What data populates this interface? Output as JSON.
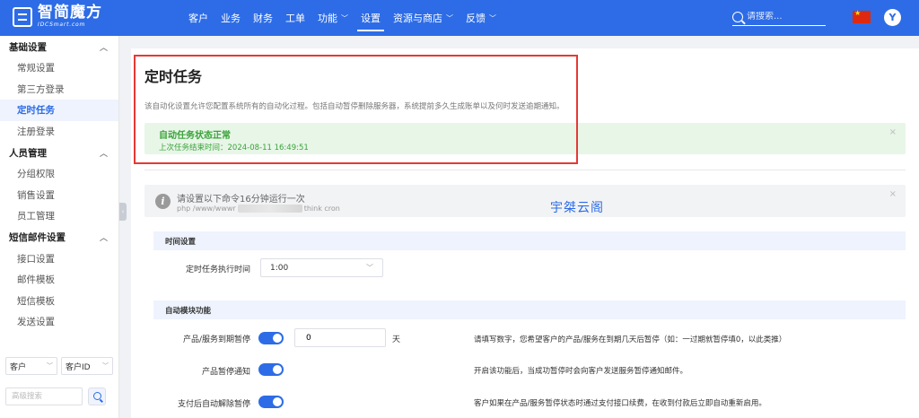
{
  "brand": {
    "name": "智简魔方",
    "sub": "IDCSmart.com"
  },
  "nav": [
    {
      "label": "客户",
      "chevron": false,
      "active": false
    },
    {
      "label": "业务",
      "chevron": false,
      "active": false
    },
    {
      "label": "财务",
      "chevron": false,
      "active": false
    },
    {
      "label": "工单",
      "chevron": false,
      "active": false
    },
    {
      "label": "功能",
      "chevron": true,
      "active": false
    },
    {
      "label": "设置",
      "chevron": false,
      "active": true
    },
    {
      "label": "资源与商店",
      "chevron": true,
      "active": false
    },
    {
      "label": "反馈",
      "chevron": true,
      "active": false
    }
  ],
  "search": {
    "placeholder": "请搜索..."
  },
  "user": {
    "avatar_letter": "Y"
  },
  "sidebar": {
    "groups": [
      {
        "title": "基础设置",
        "items": [
          {
            "label": "常规设置",
            "active": false
          },
          {
            "label": "第三方登录",
            "active": false
          },
          {
            "label": "定时任务",
            "active": true
          },
          {
            "label": "注册登录",
            "active": false
          }
        ]
      },
      {
        "title": "人员管理",
        "items": [
          {
            "label": "分组权限",
            "active": false
          },
          {
            "label": "销售设置",
            "active": false
          },
          {
            "label": "员工管理",
            "active": false
          }
        ]
      },
      {
        "title": "短信邮件设置",
        "items": [
          {
            "label": "接口设置",
            "active": false
          },
          {
            "label": "邮件模板",
            "active": false
          },
          {
            "label": "短信模板",
            "active": false
          },
          {
            "label": "发送设置",
            "active": false
          }
        ]
      }
    ],
    "filter1": "客户",
    "filter2": "客户ID",
    "adv_search_placeholder": "高级搜索"
  },
  "page": {
    "title": "定时任务",
    "description": "该自动化设置允许您配置系统所有的自动化过程。包括自动暂停删除服务器，系统提前多久生成账单以及何时发送逾期通知。",
    "status_title": "自动任务状态正常",
    "status_time": "上次任务结束时间：2024-08-11 16:49:51",
    "notice_title": "请设置以下命令16分钟运行一次",
    "cmd_prefix": "php /www/wwwr",
    "cmd_suffix": "think cron",
    "watermark": "宇桀云阁",
    "close_glyph": "×"
  },
  "time_section": {
    "header": "时间设置",
    "label": "定时任务执行时间",
    "value": "1:00"
  },
  "auto_section": {
    "header": "自动模块功能",
    "rows": [
      {
        "label": "产品/服务到期暂停",
        "input_value": "0",
        "unit": "天",
        "help": "请填写数字，您希望客户的产品/服务在到期几天后暂停（如：一过期就暂停填0，以此类推）"
      },
      {
        "label": "产品暂停通知",
        "help": "开启该功能后，当成功暂停时会向客户发送服务暂停通知邮件。"
      },
      {
        "label": "支付后自动解除暂停",
        "help": "客户如果在产品/服务暂停状态时通过支付接口续费，在收到付款后立即自动重新启用。"
      }
    ]
  },
  "colors": {
    "primary": "#2d6ce6",
    "success": "#3aa23a",
    "highlight": "#e53935"
  }
}
